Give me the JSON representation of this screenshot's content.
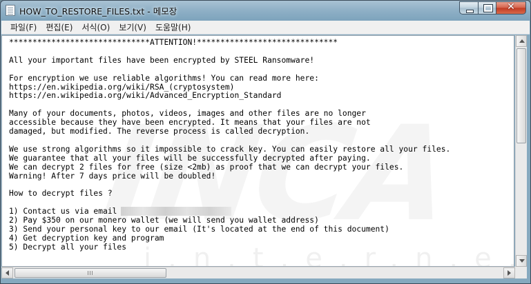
{
  "window": {
    "title": "HOW_TO_RESTORE_FILES.txt - 메모장",
    "close_glyph": "✕"
  },
  "menu": [
    "파일(F)",
    "편집(E)",
    "서식(O)",
    "보기(V)",
    "도움말(H)"
  ],
  "content": {
    "text": "******************************ATTENTION!******************************\n\nAll your important files have been encrypted by STEEL Ransomware!\n\nFor encryption we use reliable algorithms! You can read more here:\nhttps://en.wikipedia.org/wiki/RSA_(cryptosystem)\nhttps://en.wikipedia.org/wiki/Advanced_Encryption_Standard\n\nMany of your documents, photos, videos, images and other files are no longer\naccessible because they have been encrypted. It means that your files are not\ndamaged, but modified. The reverse process is called decryption.\n\nWe use strong algorithms so it impossible to crack key. You can easily restore all your files.\nWe guarantee that all your files will be successfully decrypted after paying.\nWe can decrypt 2 files for free (size <2mb) as proof that we can decrypt your files.\nWarning! After 7 days price will be doubled!\n\nHow to decrypt files ?\n\n1) Contact us via email\n2) Pay $350 on our monero wallet (we will send you wallet address)\n3) Send your personal key to our email (It's located at the end of this document)\n4) Get decryption key and program\n5) Decrypt all your files"
  },
  "watermark": {
    "main": "INCA",
    "sub": "i.n.t.e.r.n.e.t"
  },
  "icons": {
    "app": "notepad-icon",
    "minimize": "minimize-icon",
    "maximize": "maximize-icon",
    "close": "close-icon"
  },
  "colors": {
    "titlebar": "#8fb0c6",
    "close_button": "#c03a22",
    "editor_bg": "#ffffff"
  }
}
